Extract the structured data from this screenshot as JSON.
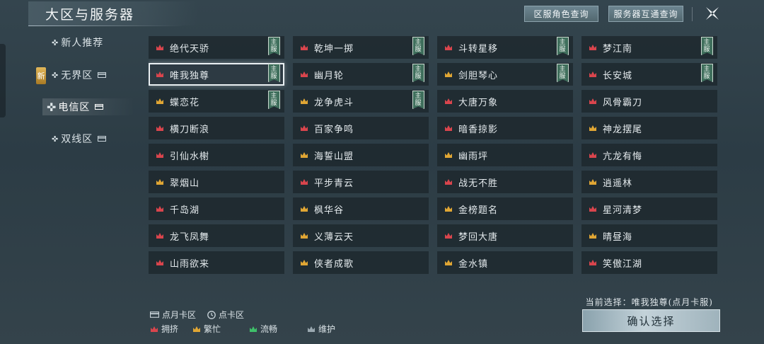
{
  "header": {
    "title": "大区与服务器",
    "btn_role_query": "区服角色查询",
    "btn_interop_query": "服务器互通查询"
  },
  "sidebar": {
    "new_badge": "新",
    "items": [
      {
        "label": "新人推荐",
        "card": false,
        "active": false
      },
      {
        "label": "无界区",
        "card": true,
        "active": false
      },
      {
        "label": "电信区",
        "card": true,
        "active": true
      },
      {
        "label": "双线区",
        "card": true,
        "active": false
      }
    ]
  },
  "colors": {
    "crowded": "#d9454d",
    "busy": "#e0a634",
    "smooth": "#3fbf6a",
    "maintenance": "#9aa8b0"
  },
  "main_tag_text": "主服",
  "servers": [
    {
      "name": "绝代天骄",
      "status": "crowded",
      "main": true
    },
    {
      "name": "乾坤一掷",
      "status": "crowded",
      "main": true
    },
    {
      "name": "斗转星移",
      "status": "crowded",
      "main": true
    },
    {
      "name": "梦江南",
      "status": "crowded",
      "main": true
    },
    {
      "name": "唯我独尊",
      "status": "crowded",
      "main": true,
      "selected": true
    },
    {
      "name": "幽月轮",
      "status": "crowded",
      "main": true
    },
    {
      "name": "剑胆琴心",
      "status": "busy",
      "main": true
    },
    {
      "name": "长安城",
      "status": "crowded",
      "main": true
    },
    {
      "name": "蝶恋花",
      "status": "busy",
      "main": true
    },
    {
      "name": "龙争虎斗",
      "status": "busy",
      "main": true
    },
    {
      "name": "大唐万象",
      "status": "crowded",
      "main": false
    },
    {
      "name": "风骨霸刀",
      "status": "crowded",
      "main": false
    },
    {
      "name": "横刀断浪",
      "status": "crowded",
      "main": false
    },
    {
      "name": "百家争鸣",
      "status": "crowded",
      "main": false
    },
    {
      "name": "暗香掠影",
      "status": "crowded",
      "main": false
    },
    {
      "name": "神龙摆尾",
      "status": "busy",
      "main": false
    },
    {
      "name": "引仙水榭",
      "status": "crowded",
      "main": false
    },
    {
      "name": "海誓山盟",
      "status": "busy",
      "main": false
    },
    {
      "name": "幽雨坪",
      "status": "busy",
      "main": false
    },
    {
      "name": "亢龙有悔",
      "status": "crowded",
      "main": false
    },
    {
      "name": "翠烟山",
      "status": "busy",
      "main": false
    },
    {
      "name": "平步青云",
      "status": "crowded",
      "main": false
    },
    {
      "name": "战无不胜",
      "status": "crowded",
      "main": false
    },
    {
      "name": "逍遥林",
      "status": "busy",
      "main": false
    },
    {
      "name": "千岛湖",
      "status": "crowded",
      "main": false
    },
    {
      "name": "枫华谷",
      "status": "busy",
      "main": false
    },
    {
      "name": "金榜题名",
      "status": "busy",
      "main": false
    },
    {
      "name": "星河清梦",
      "status": "crowded",
      "main": false
    },
    {
      "name": "龙飞凤舞",
      "status": "crowded",
      "main": false
    },
    {
      "name": "义薄云天",
      "status": "busy",
      "main": false
    },
    {
      "name": "梦回大唐",
      "status": "crowded",
      "main": false
    },
    {
      "name": "晴昼海",
      "status": "busy",
      "main": false
    },
    {
      "name": "山雨欲来",
      "status": "crowded",
      "main": false
    },
    {
      "name": "侠者成歌",
      "status": "busy",
      "main": false
    },
    {
      "name": "金水镇",
      "status": "busy",
      "main": false
    },
    {
      "name": "笑傲江湖",
      "status": "crowded",
      "main": false
    }
  ],
  "legend": {
    "monthly": "点月卡区",
    "point": "点卡区",
    "crowded": "拥挤",
    "busy": "繁忙",
    "smooth": "流畅",
    "maintenance": "维护"
  },
  "footer": {
    "current_selection": "当前选择：唯我独尊(点月卡服)",
    "confirm": "确认选择"
  }
}
